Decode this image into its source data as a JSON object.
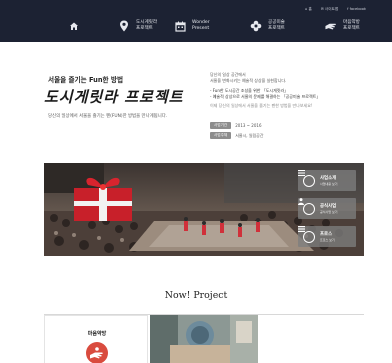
{
  "nav": {
    "util_links": [
      "⌂ 홈",
      "✉ 사이트맵",
      "f facebook"
    ],
    "menu": [
      {
        "icon": "home-icon",
        "label": ""
      },
      {
        "icon": "location-pin-icon",
        "label": "도시게릿라\n프로젝트"
      },
      {
        "icon": "calendar-icon",
        "label": "Wonder\nPresent"
      },
      {
        "icon": "flower-icon",
        "label": "공공미술\n프로젝트"
      },
      {
        "icon": "hand-icon",
        "label": "마음약방\n프로젝트"
      }
    ]
  },
  "hero": {
    "tagline": "서울을 즐기는 Fun한 방법",
    "title": "도시게릿라 프로젝트",
    "desc": "당신의 일상에서 서울을 즐기는 펜(FUN)한 방법을 만나게됩니다."
  },
  "info": {
    "line1": "당신의 일상 공간에서",
    "line2": "서울을 변화시키는 예술적 상상을 실현합니다.",
    "line3": "- Fun한 도시공간 조성을 위한 「도시게릿라」",
    "line4": "- 예술적 상상으로 서울의 문제를 해결하는 「공공미술 프로젝트」",
    "line5": "이제 당신의 일상에서 서울을 즐기는 펜한 방법을 만나보세요!",
    "period_label": "사업기간",
    "period_value": "2013 ~ 2016",
    "org_label": "사업주체",
    "org_value": "서울시, 일림공간"
  },
  "banner": {
    "buttons": [
      {
        "icon": "list-icon",
        "title": "사업소개",
        "sub": "사업내용 보기"
      },
      {
        "icon": "person-icon",
        "title": "공식사업",
        "sub": "공식사업 보기"
      },
      {
        "icon": "menu-icon",
        "title": "프로스",
        "sub": "프로스 보기"
      }
    ]
  },
  "now_project": {
    "title": "Now!  Project",
    "card1_label": "마음약방"
  },
  "colors": {
    "nav_bg": "#1c2233",
    "logo_red": "#d94b3e",
    "tag_gray": "#8d8d8d"
  }
}
